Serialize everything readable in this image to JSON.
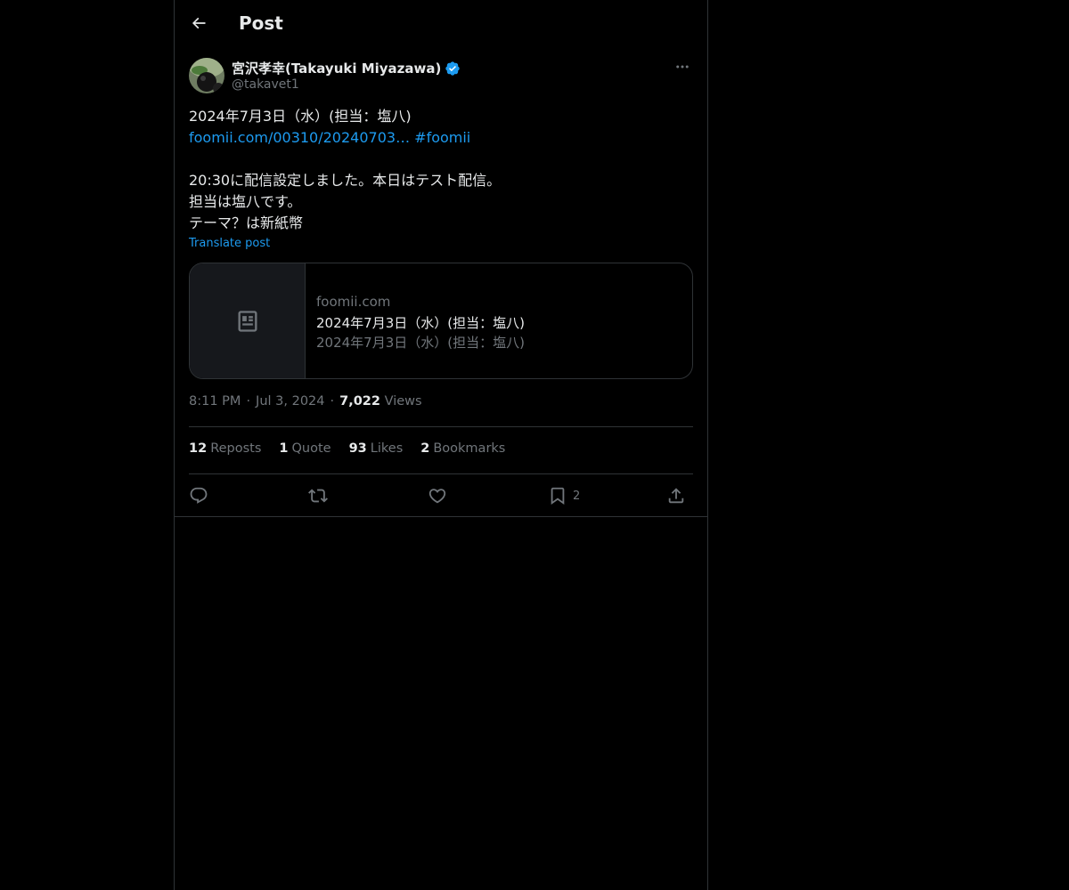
{
  "header": {
    "title": "Post"
  },
  "author": {
    "name": "宮沢孝幸(Takayuki Miyazawa)",
    "handle": "@takavet1"
  },
  "post": {
    "line1": "2024年7月3日（水）(担当：塩八)",
    "link_text": "foomii.com/00310/20240703…",
    "hashtag": "#foomii",
    "line3": "20:30に配信設定しました。本日はテスト配信。",
    "line4": "担当は塩八です。",
    "line5": "テーマ？は新紙幣",
    "translate_label": "Translate post"
  },
  "card": {
    "domain": "foomii.com",
    "title": "2024年7月3日（水）(担当：塩八)",
    "description": "2024年7月3日（水）(担当：塩八)"
  },
  "meta": {
    "time": "8:11 PM",
    "dot": "·",
    "date": "Jul 3, 2024",
    "views_count": "7,022",
    "views_label": "Views"
  },
  "stats": [
    {
      "count": "12",
      "label": "Reposts"
    },
    {
      "count": "1",
      "label": "Quote"
    },
    {
      "count": "93",
      "label": "Likes"
    },
    {
      "count": "2",
      "label": "Bookmarks"
    }
  ],
  "actions": {
    "bookmark_count": "2"
  },
  "icons": {
    "back": "arrow-left-icon",
    "verified": "verified-badge-icon",
    "more": "more-dots-icon",
    "card": "article-icon",
    "reply": "reply-icon",
    "repost": "repost-icon",
    "like": "heart-icon",
    "bookmark": "bookmark-icon",
    "share": "share-icon"
  },
  "colors": {
    "accent": "#1d9bf0",
    "background": "#000000",
    "text": "#e7e9ea",
    "muted": "#71767b",
    "border": "#2f3336"
  }
}
